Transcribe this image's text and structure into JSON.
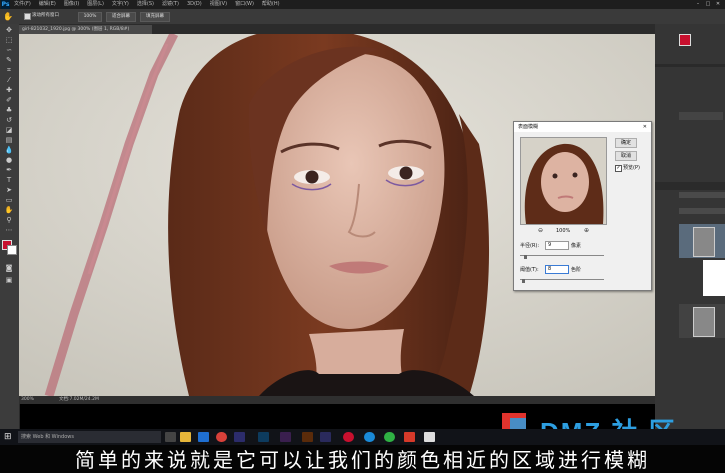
{
  "app": {
    "logo": "Ps"
  },
  "menubar": {
    "items": [
      "文件(F)",
      "编辑(E)",
      "图像(I)",
      "图层(L)",
      "文字(Y)",
      "选择(S)",
      "滤镜(T)",
      "3D(D)",
      "视图(V)",
      "窗口(W)",
      "帮助(H)"
    ]
  },
  "optionsbar": {
    "scroll_all": "滚动所有窗口",
    "zoom_value": "100%",
    "fit_screen": "适合屏幕",
    "fill_screen": "填充屏幕"
  },
  "document": {
    "tab_title": "girl-821032_1920.jpg @ 300% (图层 1, RGB/8#)",
    "status_zoom": "300%",
    "status_doc": "文档:7.02M/24.2M"
  },
  "dialog": {
    "title": "表面模糊",
    "ok": "确定",
    "cancel": "取消",
    "preview_label": "预览(P)",
    "zoom": "100%",
    "radius_label": "半径(R):",
    "radius_value": "9",
    "radius_unit": "像素",
    "threshold_label": "阈值(T):",
    "threshold_value": "8",
    "threshold_unit": "色阶"
  },
  "taskbar": {
    "search_placeholder": "搜索 Web 和 Windows"
  },
  "watermark": {
    "text": "DMZ 社 区"
  },
  "subtitle": {
    "text": "简单的来说就是它可以让我们的颜色相近的区域进行模糊"
  },
  "colors": {
    "foreground": "#c8102e",
    "background": "#ffffff",
    "dmz_blue": "#2d9ee0",
    "dmz_red": "#e0332d"
  }
}
